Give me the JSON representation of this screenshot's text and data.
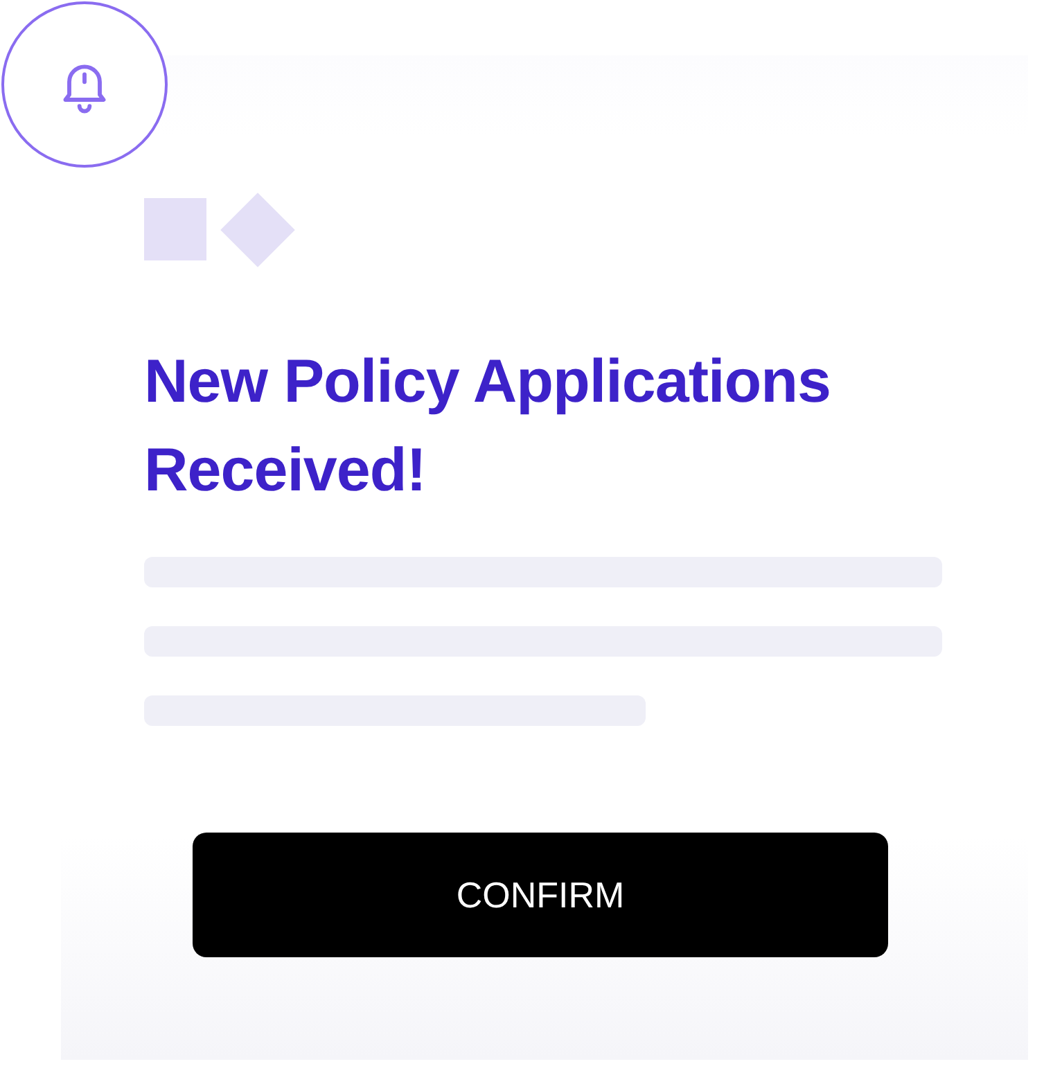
{
  "title": "New Policy Applications Received!",
  "button": {
    "label": "CONFIRM"
  }
}
